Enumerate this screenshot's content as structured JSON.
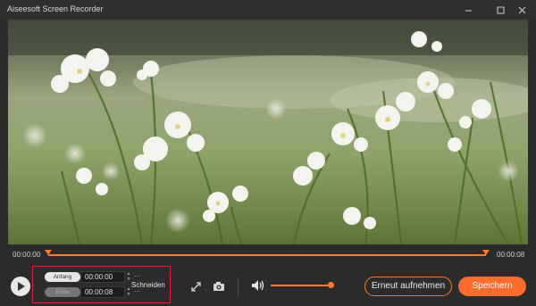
{
  "window": {
    "title": "Aiseesoft Screen Recorder"
  },
  "player": {
    "current_time": "00:00:00",
    "total_time": "00:00:08"
  },
  "trim": {
    "start_label": "Anfang",
    "start_value": "00:00:00",
    "end_label": "Ende",
    "end_value": "00:00:08",
    "cut_label": "Schneiden"
  },
  "audio": {
    "volume_level": 1.0
  },
  "actions": {
    "rerecord_label": "Erneut aufnehmen",
    "save_label": "Speichern"
  },
  "colors": {
    "accent": "#ff7a2f",
    "highlight_border": "#e0202a"
  }
}
